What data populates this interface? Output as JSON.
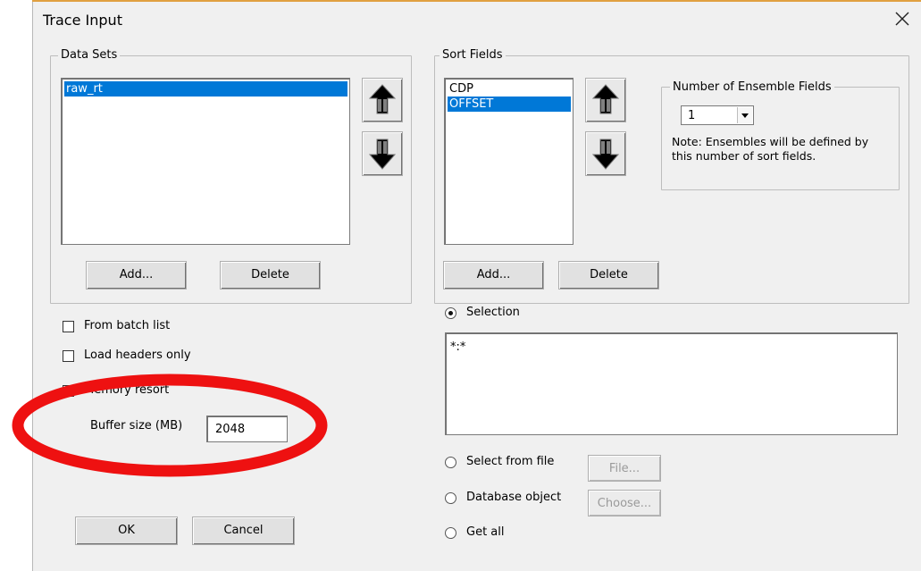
{
  "dialog": {
    "title": "Trace Input",
    "close_icon": "close-icon"
  },
  "data_sets": {
    "label": "Data Sets",
    "items": [
      "raw_rt"
    ],
    "selected_index": 0,
    "add_label": "Add...",
    "delete_label": "Delete"
  },
  "sort_fields": {
    "label": "Sort Fields",
    "items": [
      "CDP",
      "OFFSET"
    ],
    "selected_index": 1,
    "add_label": "Add...",
    "delete_label": "Delete"
  },
  "ensemble": {
    "label": "Number of Ensemble Fields",
    "value": "1",
    "note": "Note: Ensembles will be defined by this number of sort fields."
  },
  "options": {
    "from_batch_list": {
      "label": "From batch list",
      "checked": false
    },
    "load_headers_only": {
      "label": "Load headers only",
      "checked": false
    },
    "memory_resort": {
      "label": "Memory resort",
      "checked": true
    },
    "buffer_size_label": "Buffer size (MB)",
    "buffer_size_value": "2048"
  },
  "selection": {
    "selection_label": "Selection",
    "selection_value": "*:*",
    "select_from_file_label": "Select from file",
    "file_button_label": "File...",
    "database_object_label": "Database object",
    "choose_button_label": "Choose...",
    "get_all_label": "Get all",
    "selected_option": "Selection"
  },
  "footer": {
    "ok_label": "OK",
    "cancel_label": "Cancel"
  },
  "colors": {
    "accent": "#0078d7",
    "annotation_red": "#ee1111"
  }
}
